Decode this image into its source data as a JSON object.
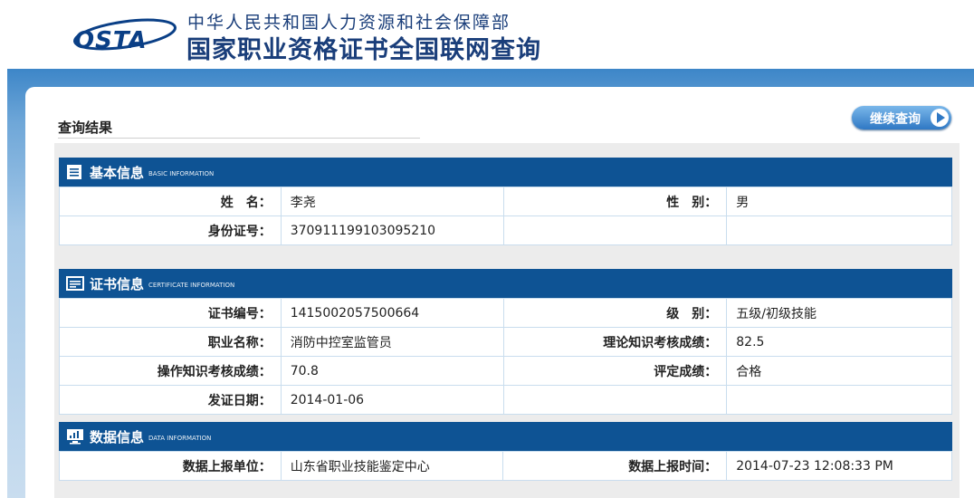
{
  "header": {
    "logo_text": "OSTA",
    "ministry": "中华人民共和国人力资源和社会保障部",
    "site_title": "国家职业资格证书全国联网查询"
  },
  "result": {
    "title": "查询结果",
    "continue_label": "继续查询"
  },
  "sections": {
    "basic": {
      "title": "基本信息",
      "title_en": "BASIC INFORMATION",
      "name_label": "姓　名：",
      "name_value": "李尧",
      "gender_label": "性　别：",
      "gender_value": "男",
      "id_label": "身份证号：",
      "id_value": "370911199103095210"
    },
    "certificate": {
      "title": "证书信息",
      "title_en": "CERTIFICATE INFORMATION",
      "cert_no_label": "证书编号：",
      "cert_no_value": "1415002057500664",
      "level_label": "级　别：",
      "level_value": "五级/初级技能",
      "occupation_label": "职业名称：",
      "occupation_value": "消防中控室监管员",
      "theory_label": "理论知识考核成绩：",
      "theory_value": "82.5",
      "operation_label": "操作知识考核成绩：",
      "operation_value": "70.8",
      "evaluation_label": "评定成绩：",
      "evaluation_value": "合格",
      "issue_date_label": "发证日期：",
      "issue_date_value": "2014-01-06"
    },
    "data": {
      "title": "数据信息",
      "title_en": "DATA INFORMATION",
      "unit_label": "数据上报单位：",
      "unit_value": "山东省职业技能鉴定中心",
      "time_label": "数据上报时间：",
      "time_value": "2014-07-23 12:08:33 PM"
    }
  },
  "colors": {
    "section_header": "#0e5394",
    "title_text": "#1a3e7a",
    "band": "#3d86c8"
  }
}
